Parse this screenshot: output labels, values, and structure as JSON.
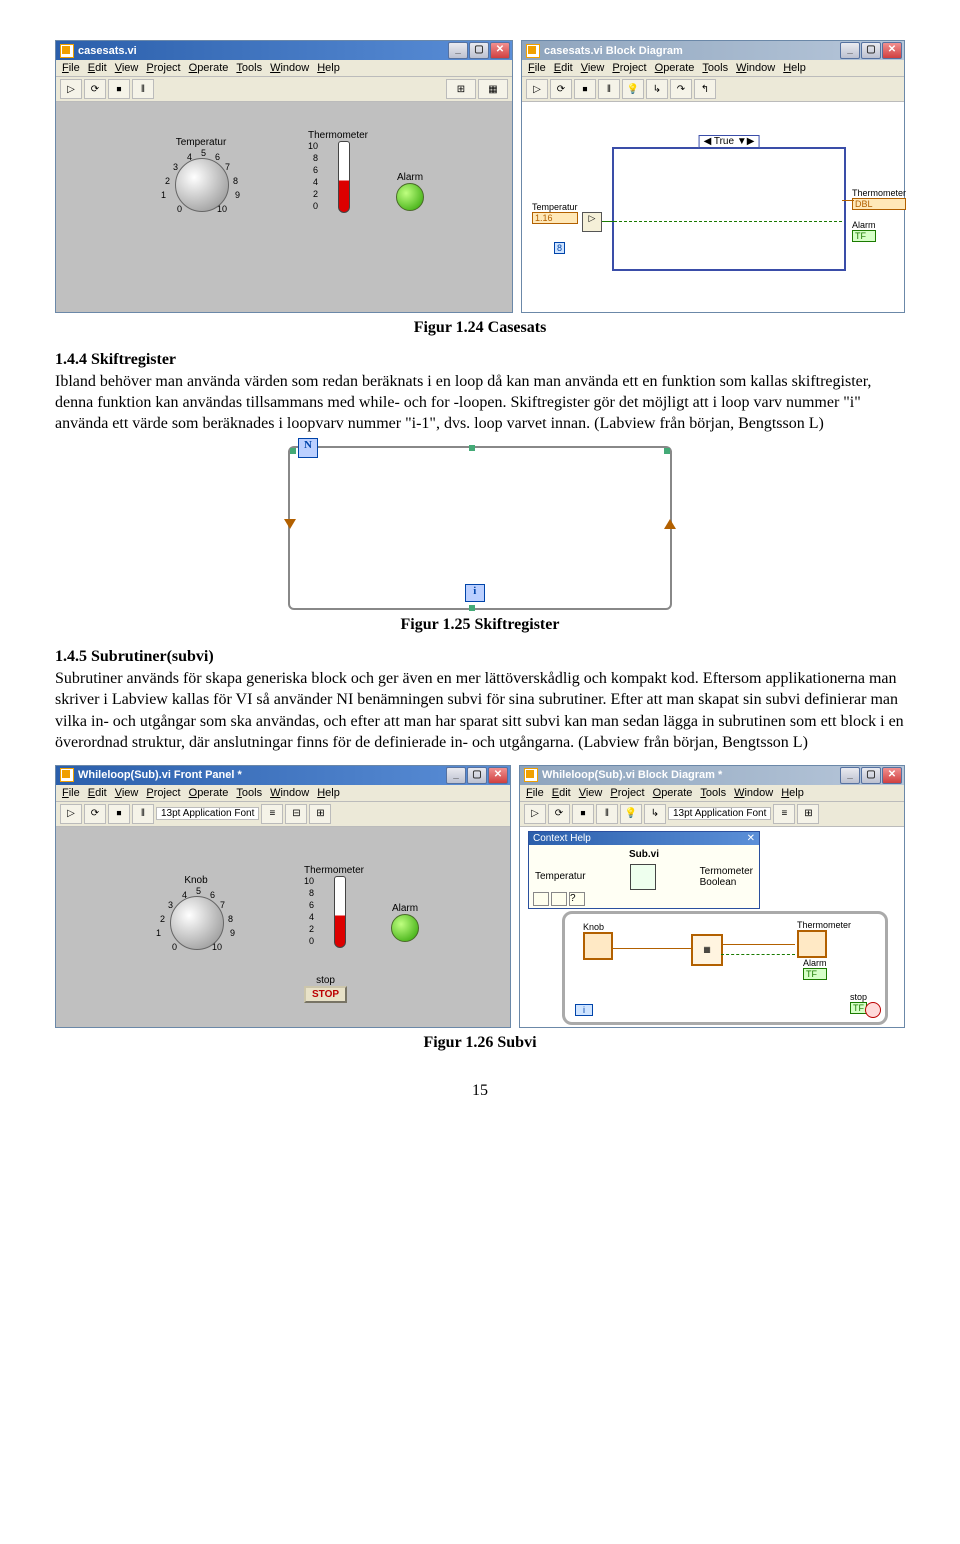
{
  "windows": {
    "casesats_fp": {
      "title": "casesats.vi"
    },
    "casesats_bd": {
      "title": "casesats.vi Block Diagram"
    },
    "whileloop_fp": {
      "title": "Whileloop(Sub).vi Front Panel *"
    },
    "whileloop_bd": {
      "title": "Whileloop(Sub).vi Block Diagram *"
    }
  },
  "menu": {
    "file": "File",
    "edit": "Edit",
    "view": "View",
    "project": "Project",
    "operate": "Operate",
    "tools": "Tools",
    "window": "Window",
    "help": "Help"
  },
  "toolbar": {
    "run": "▷",
    "run_cont": "⟳",
    "stop": "⏹",
    "pause": "‖",
    "font": "13pt Application Font"
  },
  "fp": {
    "temperatur": "Temperatur",
    "thermometer": "Thermometer",
    "alarm": "Alarm",
    "knob": "Knob",
    "stop": "stop",
    "stop_btn": "STOP",
    "scale": {
      "max": "10",
      "v8": "8",
      "v6": "6",
      "v4": "4",
      "v2": "2",
      "min": "0"
    },
    "knobscale": {
      "n0": "0",
      "n1": "1",
      "n2": "2",
      "n3": "3",
      "n4": "4",
      "n5": "5",
      "n6": "6",
      "n7": "7",
      "n8": "8",
      "n9": "9",
      "n10": "10"
    }
  },
  "bd": {
    "case_true": "◀ True ▼▶",
    "temperatur": "Temperatur",
    "temperatur_val": "1.16",
    "const_8": "8",
    "thermometer": "Thermometer",
    "alarm_out": "Alarm",
    "dbl": "DBL",
    "tf": "TF",
    "knob": "Knob",
    "stop": "stop",
    "context_help_title": "Context Help",
    "context_help_sub": "Sub.vi",
    "ch_temp": "Temperatur",
    "ch_term": "Termometer",
    "ch_bool": "Boolean"
  },
  "captions": {
    "casesats": "Figur 1.24 Casesats",
    "skiftregister": "Figur 1.25 Skiftregister",
    "subvi": "Figur 1.26 Subvi"
  },
  "sections": {
    "s144_h": "1.4.4 Skiftregister",
    "s144_p": "Ibland behöver man använda värden som redan beräknats i en loop då kan man använda ett en funktion som kallas skiftregister, denna funktion kan användas tillsammans med while- och for -loopen. Skiftregister gör det möjligt att i loop varv nummer \"i\" använda ett värde som beräknades i loopvarv nummer \"i-1\", dvs. loop varvet innan. (Labview från början, Bengtsson L)",
    "s145_h": "1.4.5 Subrutiner(subvi)",
    "s145_p": "Subrutiner används för skapa generiska block och ger även en mer lättöverskådlig och kompakt kod. Eftersom applikationerna man skriver i Labview kallas för VI så använder NI benämningen subvi för sina subrutiner. Efter att man skapat sin subvi definierar man vilka in- och utgångar som ska användas, och efter att man har sparat sitt subvi kan man sedan lägga in subrutinen som ett block i en överordnad struktur, där anslutningar finns för de definierade in- och utgångarna. (Labview från början, Bengtsson L)"
  },
  "loop_labels": {
    "n": "N",
    "i": "i"
  },
  "page_number": "15"
}
